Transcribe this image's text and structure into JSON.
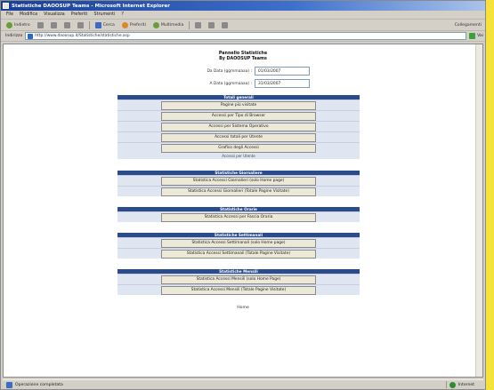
{
  "window": {
    "title": "Statistiche DAOOSUP Teams - Microsoft Internet Explorer"
  },
  "menu": [
    "File",
    "Modifica",
    "Visualizza",
    "Preferiti",
    "Strumenti",
    "?"
  ],
  "toolbar": {
    "back": "Indietro",
    "forward": "»",
    "search": "Cerca",
    "favorites": "Preferiti",
    "media": "Multimedia",
    "links": "Collegamenti"
  },
  "address": {
    "label": "Indirizzo",
    "url": "http://www.daoosup.it/Statistiche/statistiche.asp",
    "go": "Vai"
  },
  "page": {
    "title_line1": "Pannello Statistiche",
    "title_line2": "By DAOOSUP Teams",
    "date_from_label": "Da Data (ggmmaaaa) :",
    "date_from_value": "01/03/2007",
    "date_to_label": "A Data (ggmmaaaa) :",
    "date_to_value": "31/03/2007",
    "home_link": "Home"
  },
  "sections": [
    {
      "header": "Totali generali",
      "buttons": [
        "Pagine più visitate",
        "Accessi per Tipo di Browser",
        "Accessi per Sistema Operativo",
        "Accessi totali per Utente",
        "Grafico degli Accessi"
      ],
      "note": "Accessi per Utente"
    },
    {
      "header": "Statistiche Giornaliere",
      "buttons": [
        "Statistica Accessi Giornalieri (solo Home page)",
        "Statistica Accessi Giornalieri (Totale Pagine Visitate)"
      ]
    },
    {
      "header": "Statistiche Orarie",
      "buttons": [
        "Statistica Accessi per Fascia Oraria"
      ]
    },
    {
      "header": "Statistiche Settimanali",
      "buttons": [
        "Statistica Accessi Settimanali (solo Home page)",
        "Statistica Accessi Settimanali (Totale Pagine Visitate)"
      ]
    },
    {
      "header": "Statistiche Mensili",
      "buttons": [
        "Statistica Accessi Mensili (solo Home Page)",
        "Statistica Accessi Mensili (Totale Pagine Visitate)"
      ]
    }
  ],
  "status": {
    "text": "Operazione completata",
    "zone": "Internet"
  }
}
